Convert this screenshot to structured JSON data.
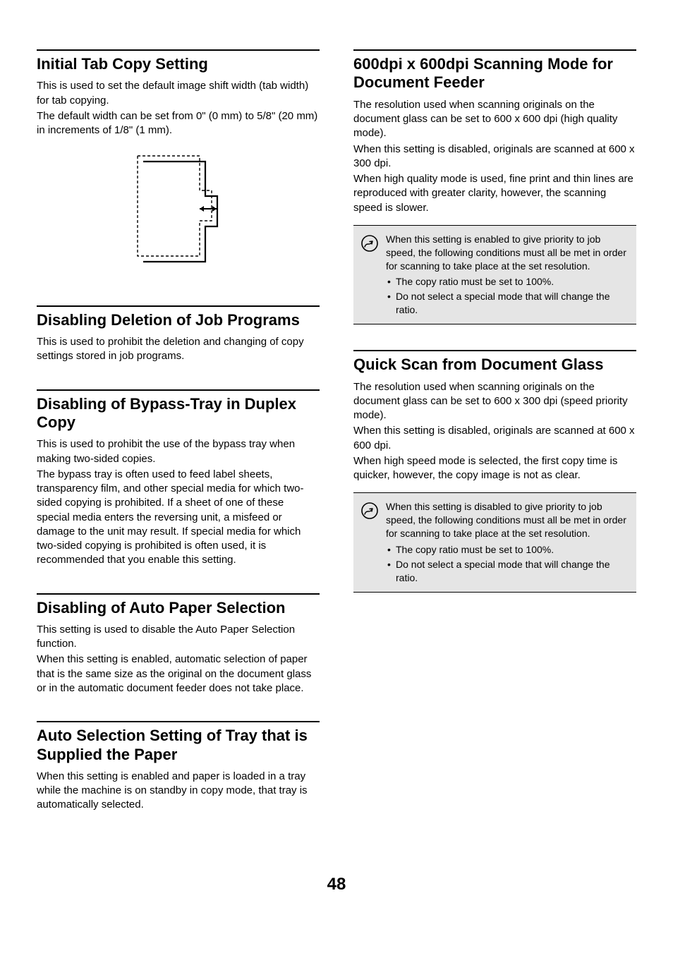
{
  "page_number": "48",
  "left": {
    "s1": {
      "title": "Initial Tab Copy Setting",
      "p1": "This is used to set the default image shift width (tab width) for tab copying.",
      "p2": "The default width can be set from 0\" (0 mm) to 5/8\" (20 mm) in increments of 1/8\" (1 mm)."
    },
    "s2": {
      "title": "Disabling Deletion of Job Programs",
      "p1": "This is used to prohibit the deletion and changing of copy settings stored in job programs."
    },
    "s3": {
      "title": "Disabling of Bypass-Tray in Duplex Copy",
      "p1": "This is used to prohibit the use of the bypass tray when making two-sided copies.",
      "p2": "The bypass tray is often used to feed label sheets, transparency film, and other special media for which two-sided copying is prohibited. If a sheet of one of these special media enters the reversing unit, a misfeed or damage to the unit may result. If special media for which two-sided copying is prohibited is often used, it is recommended that you enable this setting."
    },
    "s4": {
      "title": "Disabling of Auto Paper Selection",
      "p1": "This setting is used to disable the Auto Paper Selection function.",
      "p2": "When this setting is enabled, automatic selection of paper that is the same size as the original on the document glass or in the automatic document feeder does not take place."
    },
    "s5": {
      "title": "Auto Selection Setting of Tray that is Supplied the Paper",
      "p1": "When this setting is enabled and paper is loaded in a tray while the machine is on standby in copy mode, that tray is automatically selected."
    }
  },
  "right": {
    "s1": {
      "title": "600dpi x 600dpi Scanning Mode for Document Feeder",
      "p1": "The resolution used when scanning originals on the document glass can be set to 600 x 600 dpi (high quality mode).",
      "p2": "When this setting is disabled, originals are scanned at 600 x 300 dpi.",
      "p3": "When high quality mode is used, fine print and thin lines are reproduced with greater clarity, however, the scanning speed is slower.",
      "note": {
        "lead": "When this setting is enabled to give priority to job speed, the following conditions must all be met in order for scanning to take place at the set resolution.",
        "b1": "The copy ratio must be set to 100%.",
        "b2": "Do not select a special mode that will change the ratio."
      }
    },
    "s2": {
      "title": "Quick Scan from Document Glass",
      "p1": "The resolution used when scanning originals on the document glass can be set to 600 x 300 dpi (speed priority mode).",
      "p2": "When this setting is disabled, originals are scanned at 600 x 600 dpi.",
      "p3": "When high speed mode is selected, the first copy time is quicker, however, the copy image is not as clear.",
      "note": {
        "lead": "When this setting is disabled to give priority to job speed, the following conditions must all be met in order for scanning to take place at the set resolution.",
        "b1": "The copy ratio must be set to 100%.",
        "b2": "Do not select a special mode that will change the ratio."
      }
    }
  }
}
